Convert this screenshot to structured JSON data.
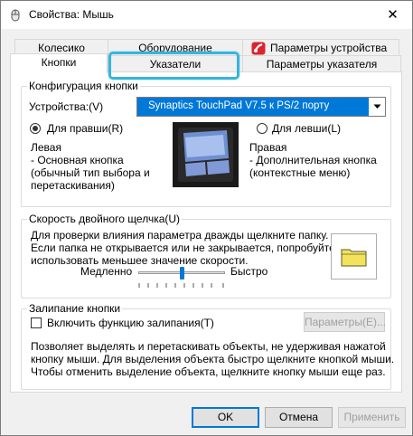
{
  "window": {
    "title": "Свойства: Мышь",
    "close_glyph": "✕"
  },
  "tabs": {
    "back_row": [
      "Колесико",
      "Оборудование",
      "Параметры устройства"
    ],
    "front_row": [
      "Кнопки",
      "Указатели",
      "Параметры указателя"
    ],
    "selected": "Кнопки",
    "highlighted": "Указатели",
    "highlight_color": "#35b5dc"
  },
  "button_config": {
    "legend": "Конфигурация кнопки",
    "device_label": "Устройства:(V)",
    "device_value": "Synaptics TouchPad V7.5 к PS/2 порту",
    "right_handed_label": "Для правши(R)",
    "left_handed_label": "Для левши(L)",
    "selected_hand": "right",
    "left_title": "Левая",
    "left_desc": [
      " - Основная кнопка",
      "(обычный тип выбора и",
      "перетаскивания)"
    ],
    "right_title": "Правая",
    "right_desc": [
      " - Дополнительная кнопка",
      "(контекстные меню)"
    ]
  },
  "double_click": {
    "legend": "Скорость двойного щелчка(U)",
    "desc": [
      "Для проверки влияния параметра дважды щелкните папку.",
      "Если папка не открывается или не закрывается, попробуйте",
      "использовать меньшее значение скорости."
    ],
    "slow_label": "Медленно",
    "fast_label": "Быстро",
    "speed_fraction": 0.5
  },
  "click_lock": {
    "legend": "Залипание кнопки",
    "checkbox_label": "Включить функцию залипания(T)",
    "checked": false,
    "params_button": "Параметры(E)...",
    "desc": [
      "Позволяет выделять и перетаскивать объекты, не удерживая нажатой",
      "кнопку мыши. Для выделения объекта быстро щелкните кнопкой мыши.",
      "Чтобы отменить выделение объекта, щелкните кнопку мыши еще раз."
    ]
  },
  "footer": {
    "ok": "OK",
    "cancel": "Отмена",
    "apply": "Применить"
  },
  "colors": {
    "accent": "#0078d7",
    "folder": "#f3e35c"
  },
  "icons": [
    "mouse-icon",
    "close-icon",
    "device-settings-icon",
    "touchpad-image",
    "folder-icon",
    "chevron-down-icon"
  ]
}
